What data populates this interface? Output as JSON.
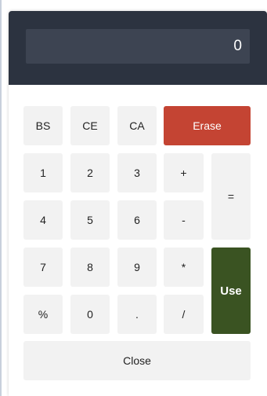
{
  "display": {
    "value": "0"
  },
  "keypad": {
    "row1": {
      "bs": "BS",
      "ce": "CE",
      "ca": "CA",
      "erase": "Erase"
    },
    "row2": {
      "k1": "1",
      "k2": "2",
      "k3": "3",
      "plus": "+"
    },
    "row3": {
      "k4": "4",
      "k5": "5",
      "k6": "6",
      "minus": "-"
    },
    "row4": {
      "k7": "7",
      "k8": "8",
      "k9": "9",
      "multiply": "*"
    },
    "row5": {
      "percent": "%",
      "k0": "0",
      "dot": ".",
      "divide": "/"
    },
    "equals": "=",
    "use": "Use",
    "close": "Close"
  },
  "colors": {
    "header_bg": "#2c3340",
    "display_bg": "#3d4452",
    "key_bg": "#f2f2f2",
    "erase_bg": "#c44433",
    "use_bg": "#3a5322"
  }
}
